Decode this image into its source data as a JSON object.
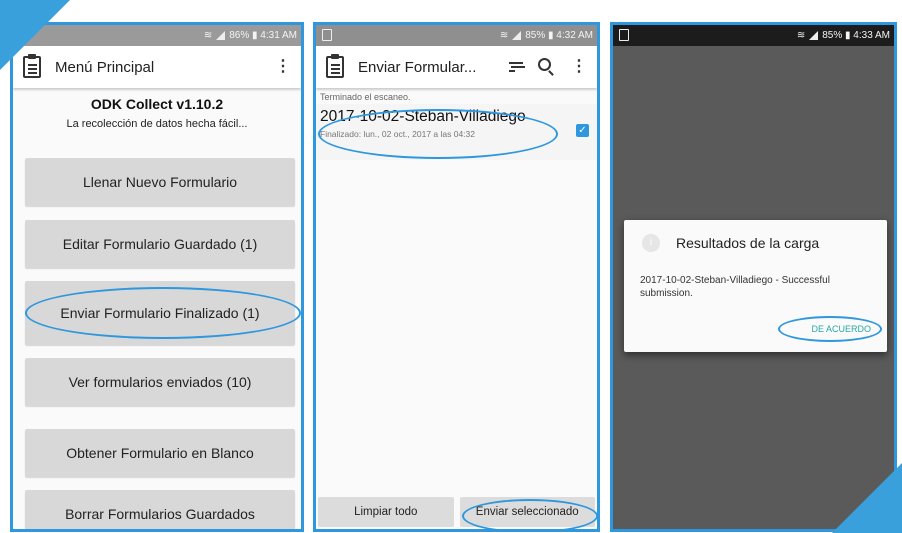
{
  "screen1": {
    "status": {
      "right_text": "86% ▮ 4:31 AM",
      "nfc": "NFC"
    },
    "appbar": {
      "title": "Menú Principal",
      "menu_icon": "kebab-icon"
    },
    "header": {
      "app_name": "ODK Collect v1.10.2",
      "tagline": "La recolección de datos hecha fácil..."
    },
    "buttons": [
      {
        "label": "Llenar Nuevo Formulario"
      },
      {
        "label": "Editar Formulario Guardado (1)"
      },
      {
        "label": "Enviar Formulario Finalizado (1)"
      },
      {
        "label": "Ver formularios enviados (10)"
      },
      {
        "label": "Obtener Formulario en Blanco"
      },
      {
        "label": "Borrar Formularios Guardados"
      }
    ]
  },
  "screen2": {
    "status": {
      "right_text": "85% ▮ 4:32 AM"
    },
    "appbar": {
      "title": "Enviar Formular...",
      "icons": [
        "sort-icon",
        "search-icon",
        "kebab-icon"
      ]
    },
    "scan_text": "Terminado el escaneo.",
    "form": {
      "name": "2017-10-02-Steban-Villadiego",
      "meta": "Finalizado: lun., 02 oct., 2017 a las 04:32",
      "checked": true
    },
    "bottom": {
      "clear_label": "Limpiar todo",
      "send_label": "Enviar seleccionado"
    }
  },
  "screen3": {
    "status": {
      "right_text": "85% ▮ 4:33 AM"
    },
    "dialog": {
      "title": "Resultados de la carga",
      "message": "2017-10-02-Steban-Villadiego - Successful submission.",
      "ok_label": "DE ACUERDO"
    }
  },
  "colors": {
    "accent": "#2f97dd",
    "dialog_button": "#2aa6a6",
    "corner": "#3aa0dc"
  }
}
